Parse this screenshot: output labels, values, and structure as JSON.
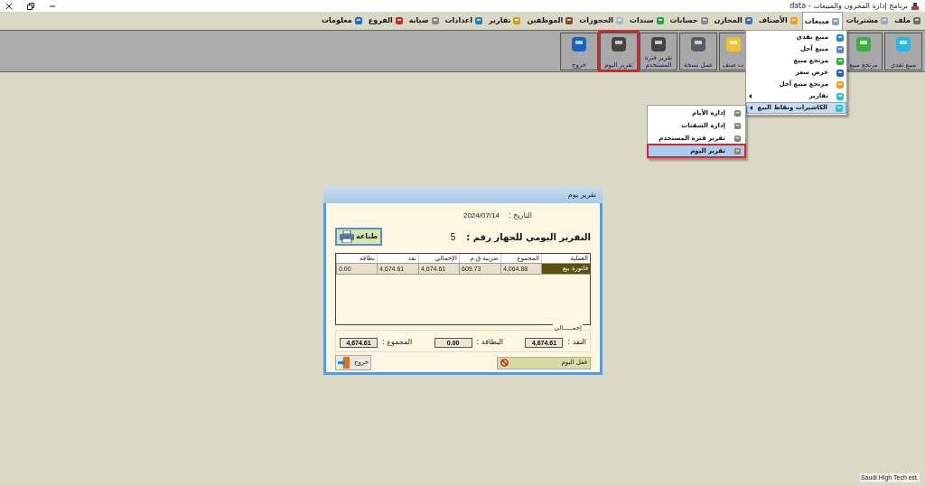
{
  "window": {
    "title": "برنامج إدارة المخزون والمبيعات - data"
  },
  "menu_bar": [
    {
      "label": "ملف",
      "selected": false
    },
    {
      "label": "مشتريات",
      "selected": false
    },
    {
      "label": "مبيعات",
      "selected": true
    },
    {
      "label": "الأصناف",
      "selected": false
    },
    {
      "label": "المخازن",
      "selected": false
    },
    {
      "label": "حسابات",
      "selected": false
    },
    {
      "label": "سندات",
      "selected": false
    },
    {
      "label": "الحجوزات",
      "selected": false
    },
    {
      "label": "الموظفين",
      "selected": false
    },
    {
      "label": "تقارير",
      "selected": false
    },
    {
      "label": "اعدادات",
      "selected": false
    },
    {
      "label": "صيانة",
      "selected": false
    },
    {
      "label": "الفروع",
      "selected": false
    },
    {
      "label": "معلومات",
      "selected": false
    }
  ],
  "toolbar": [
    {
      "label": "مبيع نقدي",
      "highlighted": false
    },
    {
      "label": "مرتجع مبيع",
      "highlighted": false
    },
    {
      "label": "ت صنف",
      "highlighted": false
    },
    {
      "label": "عمل نسخة",
      "highlighted": false
    },
    {
      "label": "تقرير فترة المستخدم",
      "highlighted": false
    },
    {
      "label": "تقرير اليوم",
      "highlighted": true
    },
    {
      "label": "خروج",
      "highlighted": false
    }
  ],
  "sales_menu": [
    {
      "label": "مبيع نقدي",
      "submenu": false,
      "selected": false
    },
    {
      "label": "مبيع آجل",
      "submenu": false,
      "selected": false
    },
    {
      "label": "مرتجع مبيع",
      "submenu": false,
      "selected": false
    },
    {
      "label": "عرض سعر",
      "submenu": false,
      "selected": false
    },
    {
      "label": "مرتجع مبيع آجل",
      "submenu": false,
      "selected": false
    },
    {
      "label": "تقارير",
      "submenu": true,
      "selected": false
    },
    {
      "label": "الكاشيرات ونقاط البيع",
      "submenu": true,
      "selected": true
    }
  ],
  "pos_submenu": [
    {
      "label": "إدارة الأيام",
      "selected": false,
      "highlighted": false
    },
    {
      "label": "إدارة الشفتات",
      "selected": false,
      "highlighted": false
    },
    {
      "label": "تقرير فترة المستخدم",
      "selected": false,
      "highlighted": false
    },
    {
      "label": "تقرير اليوم",
      "selected": true,
      "highlighted": true
    }
  ],
  "dialog": {
    "title": "تقرير يوم",
    "date_label": "التاريخ :",
    "date": "2024/07/14",
    "heading": "التقرير اليومي للجهاز رقم :",
    "device_number": "5",
    "print_button": "طباعة",
    "table": {
      "columns": [
        "العملية",
        "المجموع",
        "ضريبة ق.م",
        "الإجمالي",
        "نقد",
        "بطاقة"
      ],
      "rows": [
        {
          "cells": [
            "فاتورة بيع",
            "4,064.88",
            "609.73",
            "4,674.61",
            "4,674.61",
            "0.00"
          ],
          "selected": true
        }
      ]
    },
    "totals_legend": "إجمـــــالي",
    "totals": [
      {
        "label": "النقد :",
        "value": "4,674.61"
      },
      {
        "label": "البطاقة :",
        "value": "0.00"
      },
      {
        "label": "المجموع :",
        "value": "4,674.61"
      }
    ],
    "close_day_button": "قفل اليوم",
    "exit_button": "خروج"
  },
  "status_bar": {
    "text": "Saudi High Tech est."
  }
}
